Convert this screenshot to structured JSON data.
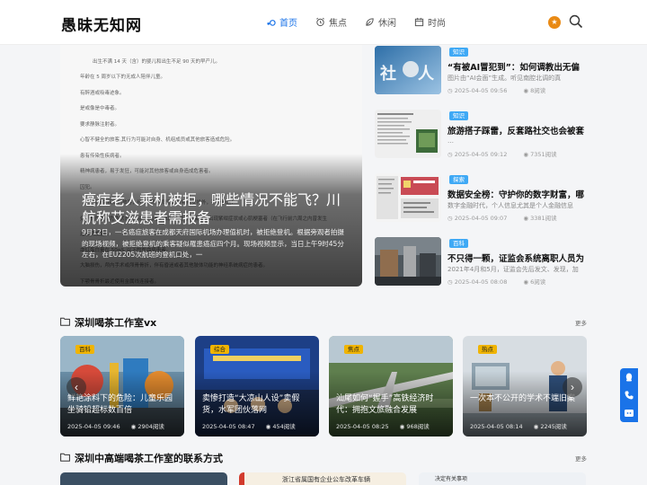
{
  "site": {
    "logo": "愚昧无知网"
  },
  "nav": {
    "items": [
      {
        "label": "首页",
        "icon": "home-icon",
        "active": true
      },
      {
        "label": "焦点",
        "icon": "alarm-clock-icon",
        "active": false
      },
      {
        "label": "休闲",
        "icon": "leaf-icon",
        "active": false
      },
      {
        "label": "时尚",
        "icon": "calendar-icon",
        "active": false
      }
    ],
    "badge": "★"
  },
  "hero": {
    "title": "癌症老人乘机被拒，哪些情况不能飞？川航称艾滋患者需报备",
    "desc": "9月12日，一名癌症旅客在成都天府国际机场办理值机时，被拒绝登机。根据旁观者拍摄的现场视频，被拒绝登机的乘客疑似罹患癌症四个月。现场视频显示，当日上午9时45分左右，在EU2205次航班的登机口处，一",
    "doc_lines": [
      {
        "text": "出生不满 14 天（含）的婴儿和出生不足 90 天的早产儿。",
        "indent": true
      },
      {
        "text": "年龄在 5 周岁以下的无成人陪伴儿童。",
        "indent": false
      },
      {
        "text": "有醉酒或吸毒迹象。",
        "indent": false
      },
      {
        "text": "是或像是中毒者。",
        "indent": false
      },
      {
        "text": "要求静脉注射者。",
        "indent": false
      },
      {
        "text": "心智不健全的旅客,其行为可能对自身、机组成员或其他旅客造成危险。",
        "indent": false
      },
      {
        "text": "患有传染性疾病者。",
        "indent": false
      },
      {
        "text": "精神病患者，易于发狂，可能对其他旅客或自身造成危害者。",
        "indent": false
      },
      {
        "text": "囚犯。",
        "indent": false
      },
      {
        "text": "有下列疾病的旅客，经成都航空同意进行特别安排外，不予承运：",
        "indent": true
      },
      {
        "text": "处于极严重或危急状态的心脏病患者。如严重的心力衰竭，出现紫绀症状或心肌梗塞者（在飞行前六周之内曾发生",
        "indent": false
      },
      {
        "text": "过心肌梗塞）。",
        "indent": false
      },
      {
        "text": "血红蛋白量在 50g/L 以下的贫血病患者。",
        "indent": false
      },
      {
        "text": "大脑损伤，颅内手术或颅骨骨折，伴有昏迷或者其他肢体功能的神经系统病症的患者。",
        "indent": false
      },
      {
        "text": "下颚骨骨折最近使用金属线连接者。",
        "indent": false
      }
    ]
  },
  "side_list": [
    {
      "tag": "知识",
      "title": "“有被AI冒犯到”：如何调教出无偏",
      "summary": "图片由“AI会面”生成。听见南腔北调的真",
      "date": "2025-04-05 09:56",
      "views": "8阅读"
    },
    {
      "tag": "知识",
      "title": "旅游搭子踩雷，反套路社交也会被套",
      "summary": "…",
      "date": "2025-04-05 09:12",
      "views": "7351阅读"
    },
    {
      "tag": "探索",
      "title": "数据安全榜：守护你的数字财富，哪",
      "summary": "数字金融时代，个人信息尤其是个人金融信息",
      "date": "2025-04-05 09:07",
      "views": "3381阅读"
    },
    {
      "tag": "百科",
      "title": "不只得一颗，证监会系统离职人员为",
      "summary": "2021年4月和5月，证监会先后发文、发现，加",
      "date": "2025-04-05 08:08",
      "views": "6阅读"
    }
  ],
  "section1": {
    "title": "深圳喝茶工作室vx",
    "more": "更多",
    "cards": [
      {
        "tag": "百科",
        "title": "鲜艳涂料下的危险：儿童乐园坐骑铅超标数百倍",
        "date": "2025-04-05 09:46",
        "views": "2904阅读"
      },
      {
        "tag": "综合",
        "title": "卖惨打造“大凉山人设”卖假货，水军团伙落网",
        "date": "2025-04-05 08:47",
        "views": "454阅读"
      },
      {
        "tag": "焦点",
        "title": "汕尾如何“握手”高铁经济时代：拥抱文旅融合发展",
        "date": "2025-04-05 08:25",
        "views": "968阅读"
      },
      {
        "tag": "热点",
        "title": "一次本不公开的学术不端旧案",
        "date": "2025-04-05 08:14",
        "views": "2245阅读"
      }
    ]
  },
  "section2": {
    "title": "深圳中高端喝茶工作室的联系方式",
    "more": "更多",
    "thumb_texts": [
      "浙江省属国有企业公车改革车辆",
      "决定有关事项"
    ]
  },
  "float_bar": {
    "icons": [
      "qq-icon",
      "phone-icon",
      "wechat-icon"
    ]
  },
  "colors": {
    "accent": "#1a73e8",
    "tag_blue": "#3fa9f5",
    "tag_yellow": "#f0b400",
    "badge_orange": "#e98a15"
  }
}
